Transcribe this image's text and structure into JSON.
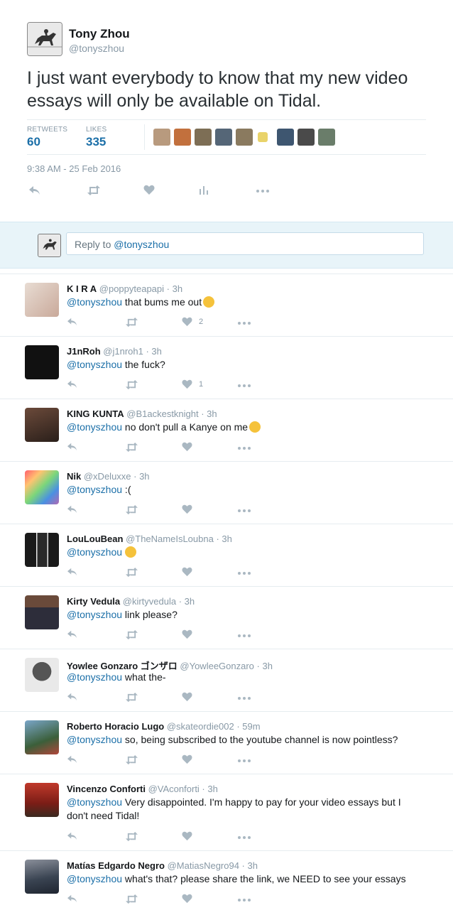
{
  "tweet": {
    "name": "Tony Zhou",
    "handle": "@tonyszhou",
    "text": "I just want everybody to know that my new video essays will only be available on Tidal.",
    "stats": {
      "retweets_label": "RETWEETS",
      "retweets": "60",
      "likes_label": "LIKES",
      "likes": "335"
    },
    "timestamp": "9:38 AM - 25 Feb 2016",
    "actions": [
      "reply-icon",
      "retweet-icon",
      "like-icon",
      "analytics-icon",
      "more-icon"
    ]
  },
  "reply_box": {
    "prefix": "Reply to ",
    "mention": "@tonyszhou"
  },
  "replies": [
    {
      "name": "K I R A",
      "meta": "@poppyteapapi · 3h",
      "mention": "@tonyszhou",
      "text": " that bums me out",
      "emoji": "pensive-face",
      "likes": "2"
    },
    {
      "name": "J1nRoh",
      "meta": "@j1nroh1 · 3h",
      "mention": "@tonyszhou",
      "text": " the fuck?",
      "likes": "1"
    },
    {
      "name": "KING KUNTA",
      "meta": "@B1ackestknight · 3h",
      "mention": "@tonyszhou",
      "text": " no don't pull a Kanye on me",
      "emoji": "weary-face"
    },
    {
      "name": "Nik",
      "meta": "@xDeluxxe · 3h",
      "mention": "@tonyszhou",
      "text": " :("
    },
    {
      "name": "LouLouBean",
      "meta": "@TheNameIsLoubna · 3h",
      "mention": "@tonyszhou",
      "text": "",
      "emoji": "astonished-face"
    },
    {
      "name": "Kirty Vedula",
      "meta": "@kirtyvedula · 3h",
      "mention": "@tonyszhou",
      "text": " link please?"
    },
    {
      "name": "Yowlee Gonzaro ゴンザロ",
      "meta": "@YowleeGonzaro · 3h",
      "mention": "@tonyszhou",
      "text": " what the-"
    },
    {
      "name": "Roberto Horacio Lugo",
      "meta": "@skateordie002 · 59m",
      "mention": "@tonyszhou",
      "text": " so, being subscribed to the youtube channel is now pointless?"
    },
    {
      "name": "Vincenzo Conforti",
      "meta": "@VAconforti · 3h",
      "mention": "@tonyszhou",
      "text": " Very disappointed. I'm happy to pay for your video essays but I don't need Tidal!"
    },
    {
      "name": "Matías Edgardo Negro",
      "meta": "@MatiasNegro94 · 3h",
      "mention": "@tonyszhou",
      "text": " what's that? please share the link, we NEED to see your essays"
    }
  ],
  "colors": {
    "link": "#1b6fa8",
    "muted": "#8899a6",
    "icon": "#aab8c2",
    "reply_bar": "#e8f4f9"
  }
}
